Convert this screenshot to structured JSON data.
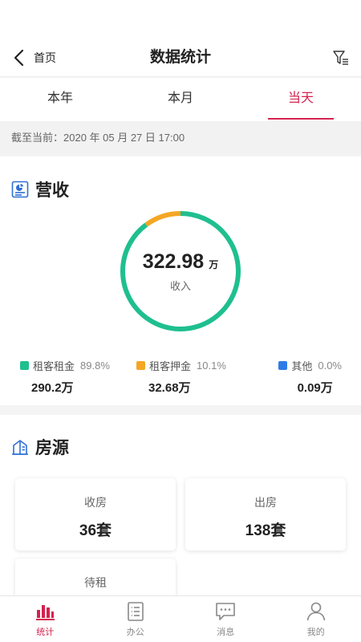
{
  "nav": {
    "back_label": "首页",
    "title": "数据统计"
  },
  "tabs": [
    {
      "label": "本年",
      "active": false
    },
    {
      "label": "本月",
      "active": false
    },
    {
      "label": "当天",
      "active": true
    }
  ],
  "as_of": {
    "text": "截至当前：2020 年 05 月 27 日 17:00"
  },
  "revenue": {
    "title": "营收",
    "total_value": "322.98",
    "total_unit": "万",
    "total_label": "收入",
    "legend": [
      {
        "name": "租客租金",
        "percent": "89.8%",
        "amount": "290.2万",
        "color": "#1fbf8f"
      },
      {
        "name": "租客押金",
        "percent": "10.1%",
        "amount": "32.68万",
        "color": "#f5a623"
      },
      {
        "name": "其他",
        "percent": "0.0%",
        "amount": "0.09万",
        "color": "#2f7be6"
      }
    ]
  },
  "chart_data": {
    "type": "pie",
    "categories": [
      "租客租金",
      "租客押金",
      "其他"
    ],
    "values": [
      89.8,
      10.1,
      0.0
    ],
    "colors": [
      "#1fbf8f",
      "#f5a623",
      "#2f7be6"
    ],
    "title": "营收"
  },
  "property": {
    "title": "房源",
    "stats": [
      {
        "label": "收房",
        "value": "36套"
      },
      {
        "label": "出房",
        "value": "138套"
      },
      {
        "label": "待租",
        "value": ""
      }
    ]
  },
  "bottom_nav": [
    {
      "label": "统计",
      "icon": "bar-chart-icon",
      "active": true
    },
    {
      "label": "办公",
      "icon": "list-icon",
      "active": false
    },
    {
      "label": "消息",
      "icon": "message-icon",
      "active": false
    },
    {
      "label": "我的",
      "icon": "user-icon",
      "active": false
    }
  ],
  "colors": {
    "accent": "#d4234f",
    "icon_blue": "#2f6fd6"
  }
}
